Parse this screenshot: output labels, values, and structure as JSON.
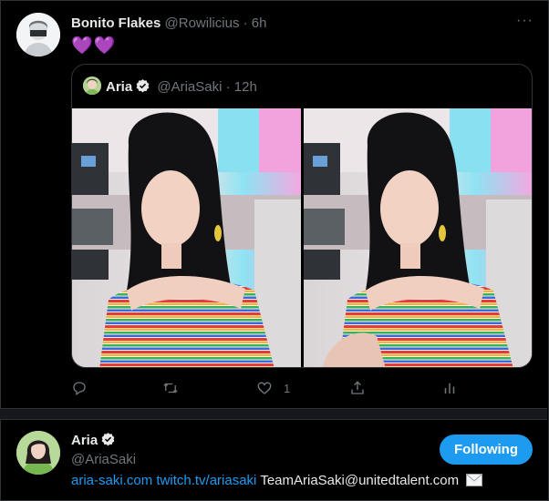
{
  "tweet": {
    "display_name": "Bonito Flakes",
    "handle": "@Rowilicius",
    "separator": "·",
    "time": "6h",
    "text": "💜💜",
    "more_label": "···"
  },
  "quoted": {
    "display_name": "Aria",
    "handle": "@AriaSaki",
    "separator": "·",
    "time": "12h"
  },
  "actions": {
    "reply_count": "",
    "retweet_count": "",
    "like_count": "1"
  },
  "profile": {
    "display_name": "Aria",
    "handle": "@AriaSaki",
    "follow_label": "Following",
    "bio_link_1": "aria-saki.com",
    "bio_link_2": "twitch.tv/ariasaki",
    "bio_text": "TeamAriaSaki@unitedtalent.com"
  },
  "colors": {
    "accent": "#1d9bf0",
    "background": "#000000",
    "muted": "#71767b",
    "heart": "#a478e8"
  }
}
